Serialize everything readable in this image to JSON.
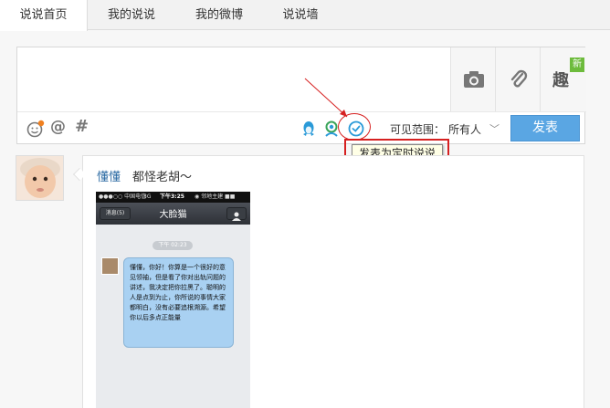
{
  "tabs": [
    {
      "label": "说说首页",
      "active": true
    },
    {
      "label": "我的说说",
      "active": false
    },
    {
      "label": "我的微博",
      "active": false
    },
    {
      "label": "说说墙",
      "active": false
    }
  ],
  "composer": {
    "fun_label": "趣",
    "new_badge": "新",
    "at_symbol": "@",
    "hash_symbol": "#",
    "visibility_label": "可见范围：",
    "visibility_value": "所有人",
    "dropdown_arrow": "﹀",
    "publish_label": "发表",
    "tooltip": "发表为定时说说"
  },
  "colors": {
    "accent": "#5aa6e3",
    "annotation_red": "#d62020",
    "link_blue": "#2b6aa3",
    "new_badge_green": "#6dbb3c"
  },
  "post": {
    "author": "懂懂",
    "text": "都怪老胡～",
    "image": {
      "status_carrier": "●●●○○ 中国电信",
      "status_network": "3G",
      "status_time": "下午3:25",
      "status_right": "◉ 邻地主建 ■■",
      "back_label": "消息(5)",
      "chat_title": "大脸猫",
      "message_time": "下午 02:23",
      "message": "懂懂，你好！你算是一个很好的意见领袖，但是看了你对出轨问题的讲述，我决定把你拉黑了。聪明的人是点到为止，你所说的事情大家都明白，没有必要追根溯源。希望你以后多点正能量"
    }
  }
}
